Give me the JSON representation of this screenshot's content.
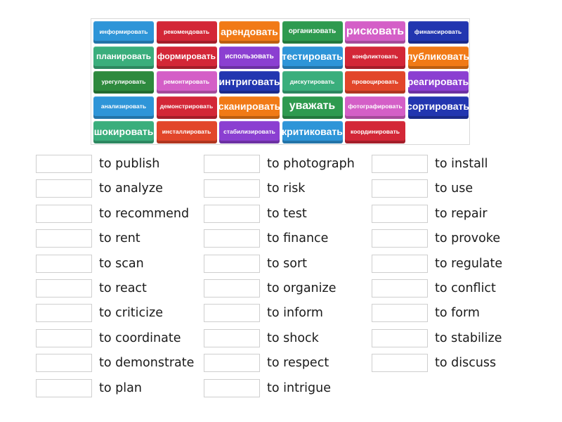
{
  "tiles": [
    {
      "text": "информировать",
      "color": "#2e95d8",
      "size": "xs"
    },
    {
      "text": "рекомендовать",
      "color": "#d32737",
      "size": "xs"
    },
    {
      "text": "арендовать",
      "color": "#f17a16",
      "size": "l"
    },
    {
      "text": "организовать",
      "color": "#2e9a4f",
      "size": "s"
    },
    {
      "text": "рисковать",
      "color": "#d45fc7",
      "size": "xl"
    },
    {
      "text": "финансировать",
      "color": "#2236b0",
      "size": "xs"
    },
    {
      "text": "планировать",
      "color": "#3aae7c",
      "size": "m"
    },
    {
      "text": "формировать",
      "color": "#d32737",
      "size": "m"
    },
    {
      "text": "использовать",
      "color": "#8b3fd1",
      "size": "s"
    },
    {
      "text": "тестировать",
      "color": "#2e95d8",
      "size": "l"
    },
    {
      "text": "конфликтовать",
      "color": "#d32737",
      "size": "xs"
    },
    {
      "text": "публиковать",
      "color": "#f17a16",
      "size": "l"
    },
    {
      "text": "урегулировать",
      "color": "#2e8a3e",
      "size": "xs"
    },
    {
      "text": "ремонтировать",
      "color": "#d45fc7",
      "size": "xs"
    },
    {
      "text": "интриговать",
      "color": "#2236b0",
      "size": "l"
    },
    {
      "text": "дискутировать",
      "color": "#3aae7c",
      "size": "xs"
    },
    {
      "text": "провоцировать",
      "color": "#e2462a",
      "size": "xs"
    },
    {
      "text": "реагировать",
      "color": "#8b3fd1",
      "size": "l"
    },
    {
      "text": "анализировать",
      "color": "#2e95d8",
      "size": "xs"
    },
    {
      "text": "демонстрировать",
      "color": "#d32737",
      "size": "xs"
    },
    {
      "text": "сканировать",
      "color": "#f17a16",
      "size": "l"
    },
    {
      "text": "уважать",
      "color": "#2e9a4f",
      "size": "xl"
    },
    {
      "text": "фотографировать",
      "color": "#d45fc7",
      "size": "xs"
    },
    {
      "text": "сортировать",
      "color": "#2236b0",
      "size": "l"
    },
    {
      "text": "шокировать",
      "color": "#3aae7c",
      "size": "l"
    },
    {
      "text": "инсталлировать",
      "color": "#e2462a",
      "size": "xs"
    },
    {
      "text": "стабилизировать",
      "color": "#8b3fd1",
      "size": "xs"
    },
    {
      "text": "критиковать",
      "color": "#2e95d8",
      "size": "l"
    },
    {
      "text": "координировать",
      "color": "#d32737",
      "size": "xs"
    }
  ],
  "targets": {
    "column1": [
      "to publish",
      "to analyze",
      "to recommend",
      "to rent",
      "to scan",
      "to react",
      "to criticize",
      "to coordinate",
      "to demonstrate",
      "to plan"
    ],
    "column2": [
      "to photograph",
      "to risk",
      "to test",
      "to finance",
      "to sort",
      "to organize",
      "to inform",
      "to shock",
      "to respect",
      "to intrigue"
    ],
    "column3": [
      "to install",
      "to use",
      "to repair",
      "to provoke",
      "to regulate",
      "to conflict",
      "to form",
      "to stabilize",
      "to discuss"
    ]
  }
}
